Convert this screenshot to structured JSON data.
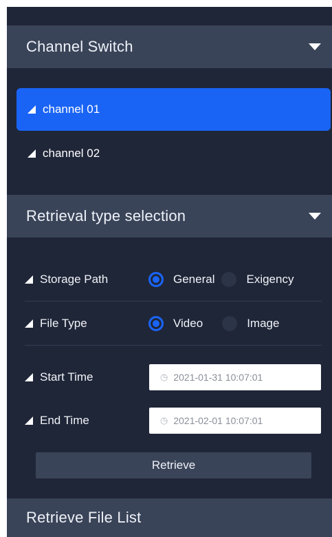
{
  "sections": {
    "channel_switch": {
      "title": "Channel Switch",
      "toggle_icon": "caret-down-icon"
    },
    "retrieval_type": {
      "title": "Retrieval type selection",
      "toggle_icon": "caret-down-icon"
    },
    "file_list": {
      "title": "Retrieve File List"
    }
  },
  "channels": [
    {
      "label": "channel 01",
      "selected": true
    },
    {
      "label": "channel 02",
      "selected": false
    }
  ],
  "storage_path": {
    "label": "Storage Path",
    "options": [
      {
        "label": "General",
        "selected": true
      },
      {
        "label": "Exigency",
        "selected": false
      }
    ]
  },
  "file_type": {
    "label": "File Type",
    "options": [
      {
        "label": "Video",
        "selected": true
      },
      {
        "label": "Image",
        "selected": false
      }
    ]
  },
  "start_time": {
    "label": "Start Time",
    "value": "2021-01-31 10:07:01",
    "icon": "clock-icon"
  },
  "end_time": {
    "label": "End Time",
    "value": "2021-02-01 10:07:01",
    "icon": "clock-icon"
  },
  "retrieve_button": {
    "label": "Retrieve"
  },
  "colors": {
    "background": "#1f2638",
    "header": "#3a4458",
    "accent": "#1a64f5",
    "input_bg": "#ffffff"
  }
}
